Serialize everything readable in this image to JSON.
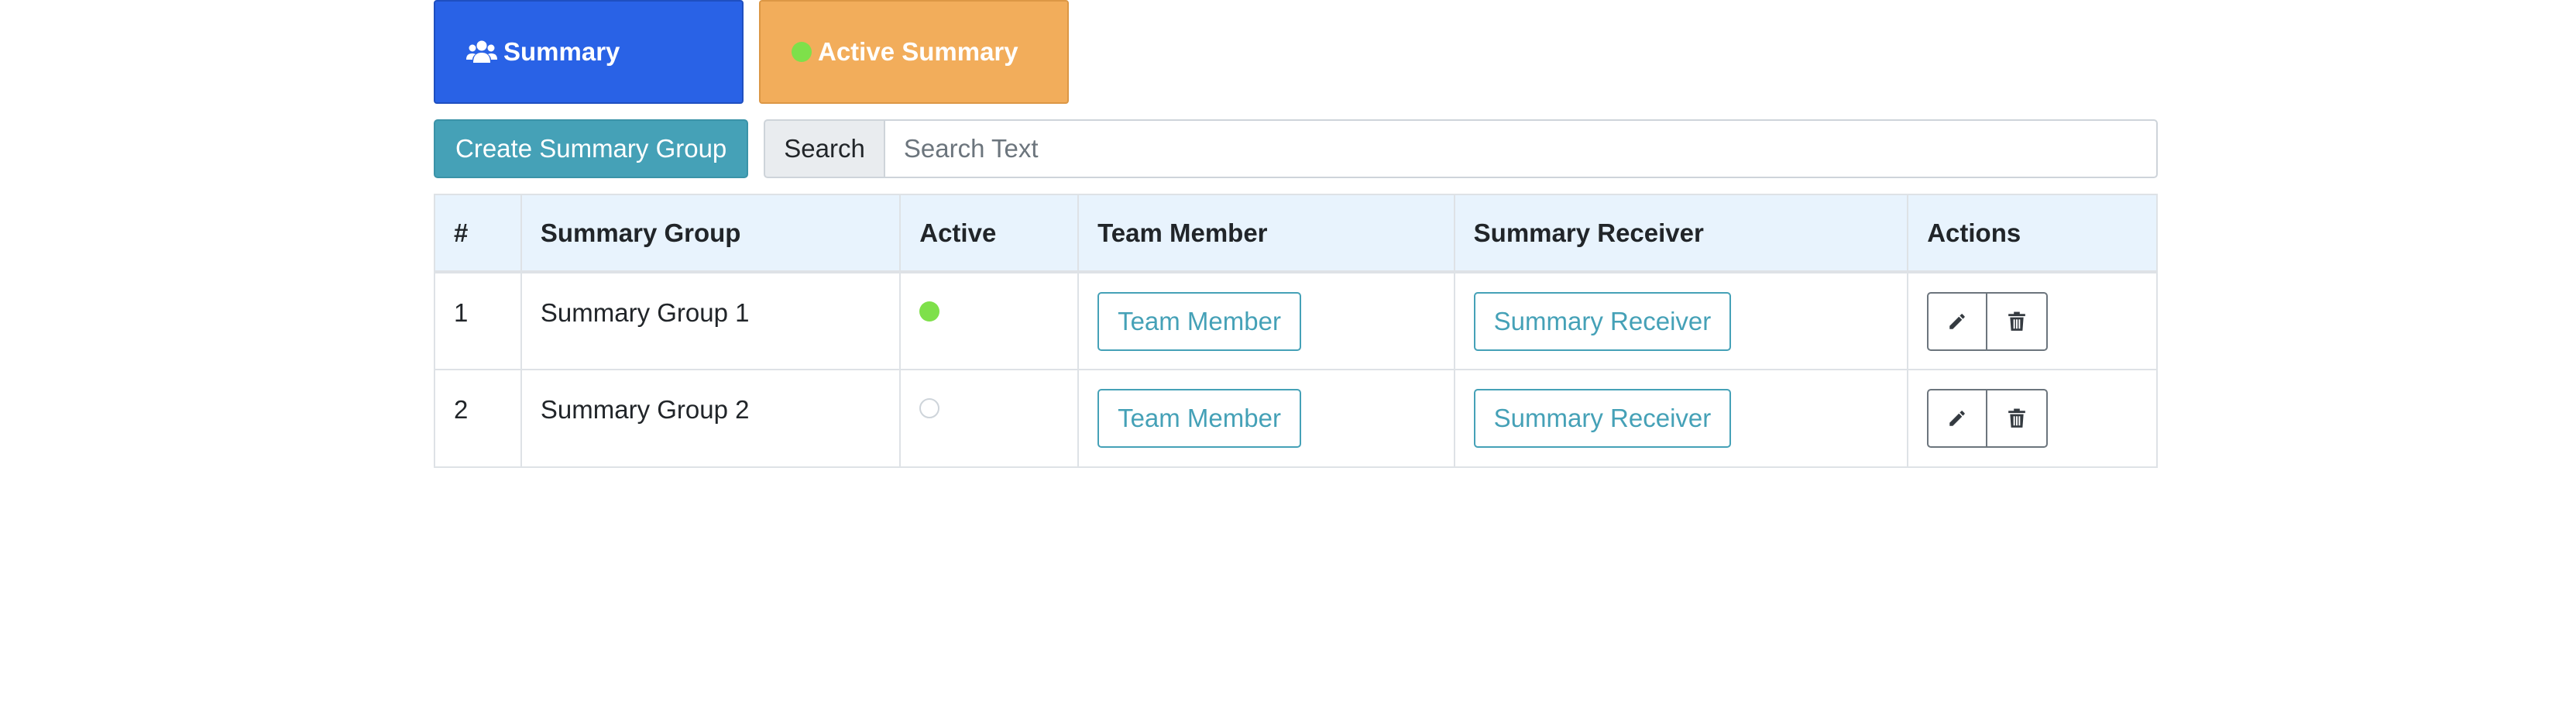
{
  "cards": {
    "summary": {
      "label": "Summary",
      "icon": "users-icon",
      "color": "#2962e6"
    },
    "active": {
      "label": "Active Summary",
      "icon": "green-dot-icon",
      "color": "#f2ad5b"
    }
  },
  "toolbar": {
    "create_label": "Create Summary Group",
    "search_label": "Search",
    "search_placeholder": "Search Text",
    "search_value": ""
  },
  "table": {
    "headers": [
      "#",
      "Summary Group",
      "Active",
      "Team Member",
      "Summary Receiver",
      "Actions"
    ],
    "rows": [
      {
        "num": "1",
        "group": "Summary Group 1",
        "active": true,
        "team_button": "Team Member",
        "receiver_button": "Summary Receiver"
      },
      {
        "num": "2",
        "group": "Summary Group 2",
        "active": false,
        "team_button": "Team Member",
        "receiver_button": "Summary Receiver"
      }
    ]
  },
  "colors": {
    "accent_blue": "#2962e6",
    "accent_orange": "#f2ad5b",
    "teal": "#45a1b7",
    "active_green": "#7ee04a",
    "header_bg": "#e8f3fd"
  }
}
